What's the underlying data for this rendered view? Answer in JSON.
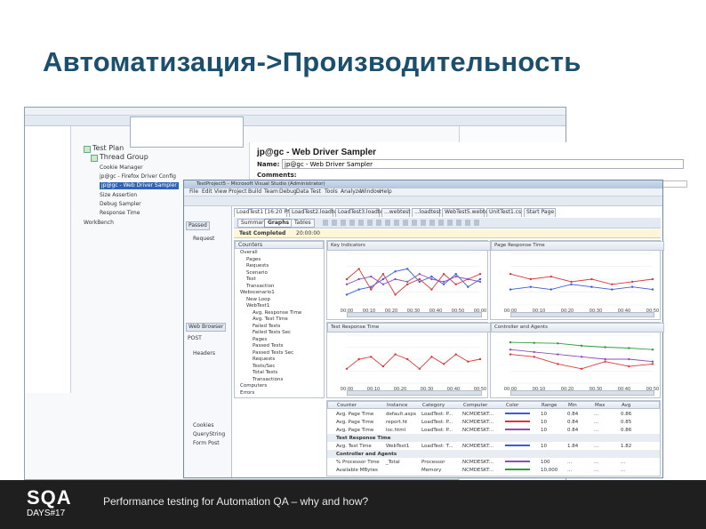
{
  "slide": {
    "title": "Автоматизация->Производительность",
    "footer_text": "Performance testing for Automation QA – why and how?",
    "logo_main": "SQA",
    "logo_sub": "DAYS#17"
  },
  "jmeter": {
    "tree": {
      "test_plan": "Test Plan",
      "thread_group": "Thread Group",
      "items": [
        "Cookie Manager",
        "jp@gc - Firefox Driver Config",
        "jp@gc - Web Driver Sampler",
        "Size Assertion",
        "Debug Sampler",
        "Response Time",
        "WorkBench"
      ]
    },
    "sampler_title": "jp@gc - Web Driver Sampler",
    "name_label": "Name:",
    "name_value": "jp@gc - Web Driver Sampler",
    "comments_label": "Comments:"
  },
  "vs": {
    "window_title": "TestProject5 - Microsoft Visual Studio (Administrator)",
    "menu": [
      "File",
      "Edit",
      "View",
      "Project",
      "Build",
      "Team",
      "Debug",
      "Data",
      "Test",
      "Tools",
      "Analyze",
      "Window",
      "Help"
    ],
    "doc_tabs": [
      "LoadTest1 [16:20 PM]",
      "LoadTest2.loadtest",
      "LoadTest3.loadtest",
      "...webtest",
      "...loadtest",
      "WebTest5.webtest",
      "UnitTest1.cs",
      "Start Page"
    ],
    "view_tabs": [
      "Summary",
      "Graphs",
      "Tables"
    ],
    "status": "Test Completed",
    "status_time": "20:00:00",
    "left_tabs": [
      "Passed",
      "Web Browser"
    ],
    "left_labels": [
      "Request",
      "POST",
      "Headers",
      "Cookies",
      "QueryString",
      "Form Post"
    ],
    "counters_header": "Counters",
    "counters_tree": [
      "Overall",
      "Pages",
      "Requests",
      "Scenario",
      "Test",
      "Transaction",
      "Webscenario1",
      "New Loop",
      "WebTest1",
      "Avg. Response Time",
      "Avg. Test Time",
      "Failed Tests",
      "Failed Tests Sec",
      "Pages",
      "Passed Tests",
      "Passed Tests Sec",
      "Requests",
      "Tests/Sec",
      "Total Tests",
      "Transactions",
      "Computers",
      "Errors"
    ],
    "charts": [
      {
        "title": "Key Indicators",
        "ticks": [
          "00:00",
          "00:10",
          "00:20",
          "00:30",
          "00:40",
          "00:50",
          "00:00"
        ]
      },
      {
        "title": "Page Response Time",
        "ticks": [
          "00:00",
          "00:10",
          "00:20",
          "00:30",
          "00:40",
          "00:50"
        ]
      },
      {
        "title": "Test Response Time",
        "ticks": [
          "00:00",
          "00:10",
          "00:20",
          "00:30",
          "00:40",
          "00:50"
        ]
      },
      {
        "title": "Controller and Agents",
        "ticks": [
          "00:00",
          "00:10",
          "00:20",
          "00:30",
          "00:40",
          "00:50"
        ]
      }
    ],
    "table": {
      "headers": [
        "Counter",
        "Instance",
        "Category",
        "Computer",
        "Color",
        "Range",
        "Min",
        "Max",
        "Avg"
      ],
      "rows": [
        [
          "Avg. Page Time",
          "default.aspx",
          "LoadTest: P...",
          "NCMDESKT...",
          "",
          "10",
          "0.84",
          "...",
          "0.86"
        ],
        [
          "Avg. Page Time",
          "report.ht",
          "LoadTest: P...",
          "NCMDESKT...",
          "",
          "10",
          "0.84",
          "...",
          "0.85"
        ],
        [
          "Avg. Page Time",
          "loc.html",
          "LoadTest: P...",
          "NCMDESKT...",
          "",
          "10",
          "0.84",
          "...",
          "0.86"
        ],
        [
          "Test Response Time",
          "",
          "",
          "",
          "",
          "",
          "",
          "",
          ""
        ],
        [
          "Avg. Test Time",
          "WebTest1",
          "LoadTest: T...",
          "NCMDESKT...",
          "",
          "10",
          "1.84",
          "...",
          "1.82"
        ],
        [
          "Controller and Agents",
          "",
          "",
          "",
          "",
          "",
          "",
          "",
          ""
        ],
        [
          "% Processor Time",
          "_Total",
          "Processor",
          "NCMDESKT...",
          "",
          "100",
          "...",
          "...",
          "..."
        ],
        [
          "Available MBytes",
          "",
          "Memory",
          "NCMDESKT...",
          "",
          "10,000",
          "...",
          "...",
          "..."
        ]
      ]
    }
  },
  "colors": {
    "title": "#1b4f6e",
    "footer_bg": "#1f1f1f",
    "logo_accent": "#e8262c",
    "series_blue": "#3b5bd9",
    "series_red": "#d9383b",
    "series_purple": "#8d4fb5",
    "series_green": "#2e9b3e"
  }
}
